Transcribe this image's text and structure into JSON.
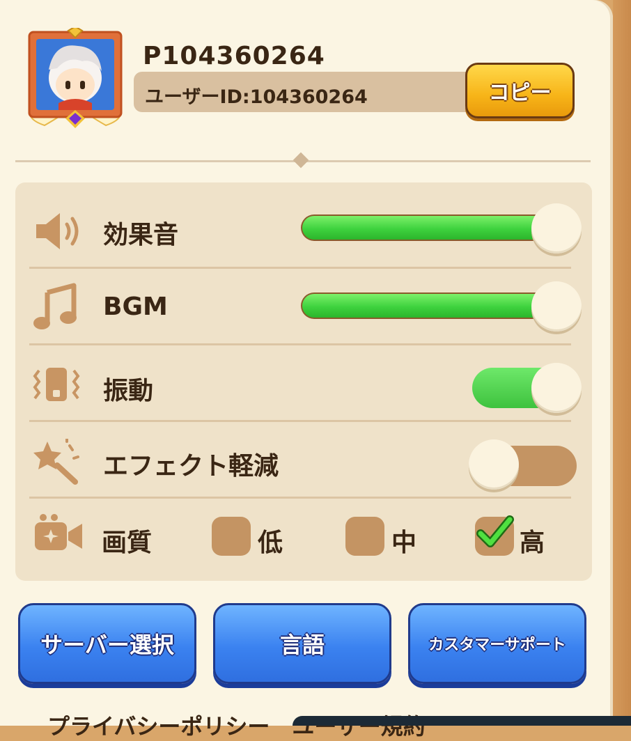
{
  "profile": {
    "player_name": "P104360264",
    "user_id": "ユーザーID:104360264",
    "copy_label": "コピー"
  },
  "settings": {
    "sfx": {
      "label": "効果音",
      "level": 1.0
    },
    "bgm": {
      "label": "BGM",
      "level": 1.0
    },
    "vibration": {
      "label": "振動",
      "on": true
    },
    "effect_reduction": {
      "label": "エフェクト軽減",
      "on": false
    },
    "quality": {
      "label": "画質",
      "options": [
        "低",
        "中",
        "高"
      ],
      "selected": "高"
    }
  },
  "buttons": {
    "server": "サーバー選択",
    "language": "言語",
    "support": "カスタマーサポート"
  },
  "footer": {
    "links_text": "プライバシーポリシー　ユーザー規約"
  },
  "colors": {
    "accent_green": "#3ed23e",
    "copy_yellow": "#f7b418",
    "button_blue": "#3b82f0",
    "panel_bg": "#fbf5e3"
  }
}
